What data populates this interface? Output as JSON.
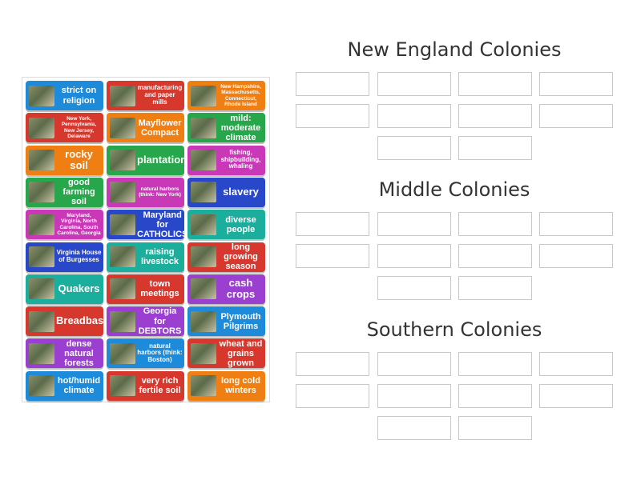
{
  "card_colors": {
    "blue": "#1d8bd9",
    "red": "#d6382e",
    "orange": "#f07f13",
    "green": "#28a64b",
    "purple": "#9b3fd1",
    "magenta": "#c938b7",
    "navy": "#2947c9",
    "teal": "#1cae9c"
  },
  "cards": [
    {
      "text": "strict on religion",
      "color": "blue",
      "icon": "religion-photo-icon"
    },
    {
      "text": "manufacturing and paper mills",
      "color": "red",
      "icon": "mill-photo-icon"
    },
    {
      "text": "New Hampshire, Massachusetts, Connecticut, Rhode Island",
      "color": "orange",
      "icon": "new-england-map-icon"
    },
    {
      "text": "New York, Pennsylvania, New Jersey, Delaware",
      "color": "red",
      "icon": "middle-colonies-map-icon"
    },
    {
      "text": "Mayflower Compact",
      "color": "orange",
      "icon": "compact-document-icon"
    },
    {
      "text": "mild: moderate climate",
      "color": "green",
      "icon": "landscape-photo-icon"
    },
    {
      "text": "rocky soil",
      "color": "orange",
      "icon": "rocks-photo-icon"
    },
    {
      "text": "plantations",
      "color": "green",
      "icon": "plantation-photo-icon"
    },
    {
      "text": "fishing, shipbuilding, whaling",
      "color": "magenta",
      "icon": "whale-photo-icon"
    },
    {
      "text": "good farming soil",
      "color": "green",
      "icon": "soil-photo-icon"
    },
    {
      "text": "natural harbors (think: New York)",
      "color": "magenta",
      "icon": "harbor-photo-icon"
    },
    {
      "text": "slavery",
      "color": "navy",
      "icon": "slavery-photo-icon"
    },
    {
      "text": "Maryland, Virginia, North Carolina, South Carolina, Georgia",
      "color": "magenta",
      "icon": "southern-map-icon"
    },
    {
      "text": "Maryland for CATHOLICS",
      "color": "navy",
      "icon": "catholic-painting-icon"
    },
    {
      "text": "diverse people",
      "color": "teal",
      "icon": "people-photo-icon"
    },
    {
      "text": "Virginia House of Burgesses",
      "color": "navy",
      "icon": "burgesses-painting-icon"
    },
    {
      "text": "raising livestock",
      "color": "teal",
      "icon": "livestock-photo-icon"
    },
    {
      "text": "long growing season",
      "color": "red",
      "icon": "crop-field-photo-icon"
    },
    {
      "text": "Quakers",
      "color": "teal",
      "icon": "quaker-logo-icon"
    },
    {
      "text": "town meetings",
      "color": "red",
      "icon": "meeting-photo-icon"
    },
    {
      "text": "cash crops",
      "color": "purple",
      "icon": "cotton-photo-icon"
    },
    {
      "text": "Breadbasket",
      "color": "red",
      "icon": "bread-basket-photo-icon"
    },
    {
      "text": "Georgia for DEBTORS",
      "color": "purple",
      "icon": "debtors-photo-icon"
    },
    {
      "text": "Plymouth Pilgrims",
      "color": "blue",
      "icon": "pilgrims-painting-icon"
    },
    {
      "text": "dense natural forests",
      "color": "purple",
      "icon": "forest-photo-icon"
    },
    {
      "text": "natural harbors (think: Boston)",
      "color": "blue",
      "icon": "boston-harbor-photo-icon"
    },
    {
      "text": "wheat and grains grown",
      "color": "red",
      "icon": "wheat-photo-icon"
    },
    {
      "text": "hot/humid climate",
      "color": "blue",
      "icon": "humidity-icon"
    },
    {
      "text": "very rich fertile soil",
      "color": "red",
      "icon": "fertile-soil-photo-icon"
    },
    {
      "text": "long cold winters",
      "color": "orange",
      "icon": "winter-photo-icon"
    }
  ],
  "groups": [
    {
      "title": "New England Colonies",
      "slots": 10
    },
    {
      "title": "Middle Colonies",
      "slots": 10
    },
    {
      "title": "Southern Colonies",
      "slots": 10
    }
  ]
}
